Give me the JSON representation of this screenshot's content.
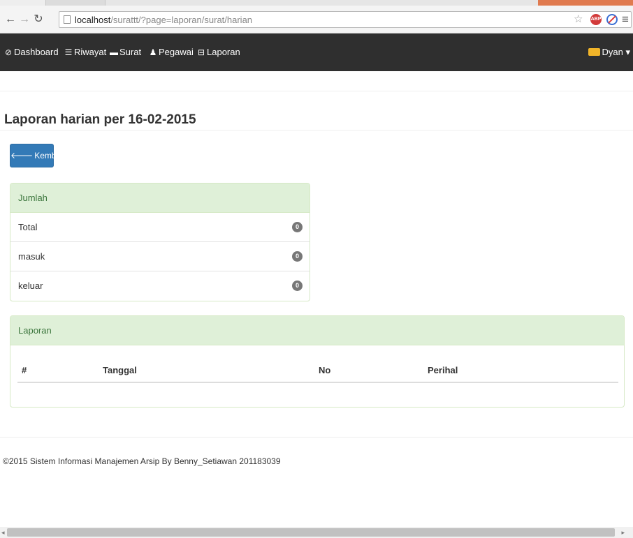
{
  "browser": {
    "url_host": "localhost",
    "url_path": "/surattt/?page=laporan/surat/harian"
  },
  "navbar": {
    "items": [
      {
        "label": "Dashboard",
        "icon": "dashboard-icon"
      },
      {
        "label": "Riwayat",
        "icon": "list-icon"
      },
      {
        "label": "Surat",
        "icon": "inbox-icon"
      },
      {
        "label": "Pegawai",
        "icon": "user-icon"
      },
      {
        "label": "Laporan",
        "icon": "print-icon"
      }
    ],
    "user": "Dyan"
  },
  "page": {
    "title": "Laporan harian per 16-02-2015",
    "back_label": "Kembali"
  },
  "summary": {
    "heading": "Jumlah",
    "rows": [
      {
        "label": "Total",
        "count": "0"
      },
      {
        "label": "masuk",
        "count": "0"
      },
      {
        "label": "keluar",
        "count": "0"
      }
    ]
  },
  "report": {
    "heading": "Laporan",
    "columns": [
      "#",
      "Tanggal",
      "No",
      "Perihal"
    ]
  },
  "footer": {
    "text": "©2015 Sistem Informasi Manajemen Arsip By Benny_Setiawan 201183039"
  },
  "colors": {
    "navbar": "#2f2f2f",
    "primary_button": "#337ab7",
    "panel_heading": "#dff0d8",
    "panel_heading_text": "#3c763d"
  }
}
